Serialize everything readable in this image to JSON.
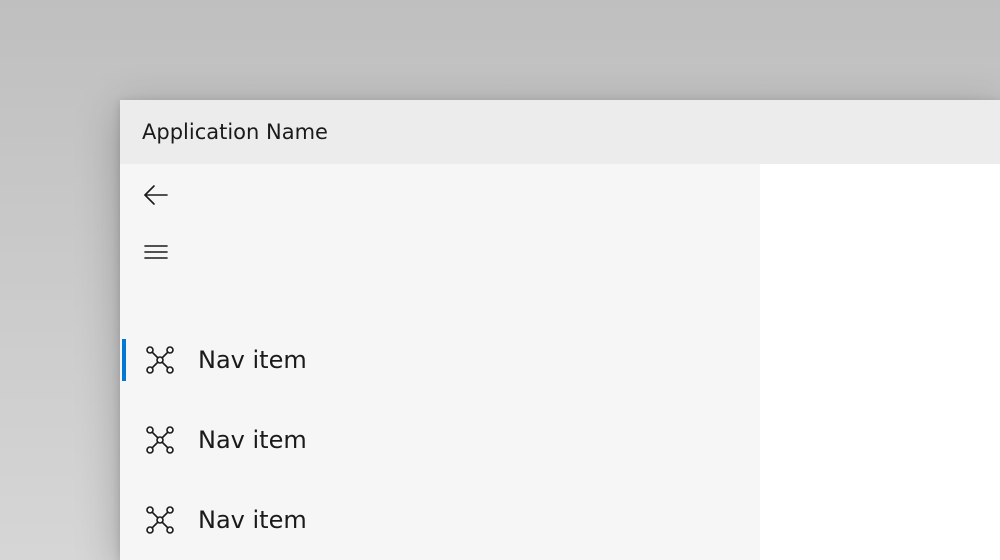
{
  "window": {
    "title": "Application Name"
  },
  "nav": {
    "items": [
      {
        "label": "Nav item",
        "selected": true
      },
      {
        "label": "Nav item",
        "selected": false
      },
      {
        "label": "Nav item",
        "selected": false
      }
    ]
  },
  "colors": {
    "accent": "#0078d4"
  }
}
